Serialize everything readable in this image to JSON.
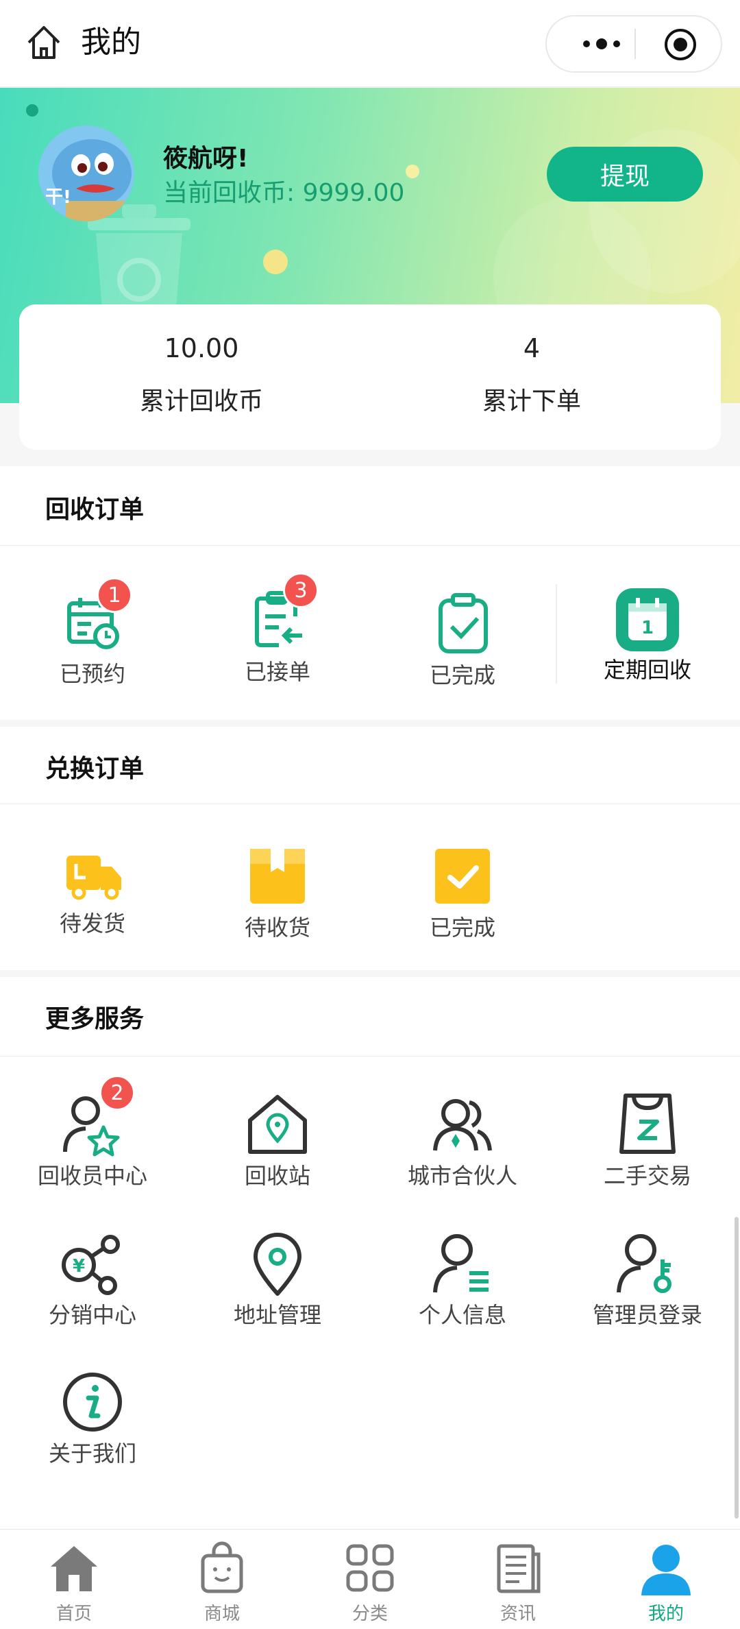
{
  "header": {
    "title": "我的",
    "icons": [
      "home-icon",
      "more-dots-icon",
      "record-target-icon"
    ]
  },
  "user": {
    "name": "筱航呀!",
    "coins_text": "当前回收币: 9999.00",
    "avatar_caption": "干!",
    "withdraw_label": "提现"
  },
  "stats": [
    {
      "value": "10.00",
      "label": "累计回收币"
    },
    {
      "value": "4",
      "label": "累计下单"
    }
  ],
  "recycle_orders": {
    "title": "回收订单",
    "items": [
      {
        "label": "已预约",
        "badge": "1",
        "icon": "calendar-clock-icon"
      },
      {
        "label": "已接单",
        "badge": "3",
        "icon": "clipboard-return-icon"
      },
      {
        "label": "已完成",
        "icon": "clipboard-check-icon"
      },
      {
        "label": "定期回收",
        "icon": "calendar-day-icon"
      }
    ]
  },
  "exchange_orders": {
    "title": "兑换订单",
    "items": [
      {
        "label": "待发货",
        "icon": "truck-icon"
      },
      {
        "label": "待收货",
        "icon": "package-icon"
      },
      {
        "label": "已完成",
        "icon": "check-square-icon"
      }
    ]
  },
  "services": {
    "title": "更多服务",
    "items": [
      {
        "label": "回收员中心",
        "badge": "2",
        "icon": "user-star-icon"
      },
      {
        "label": "回收站",
        "icon": "house-location-icon"
      },
      {
        "label": "城市合伙人",
        "icon": "users-icon"
      },
      {
        "label": "二手交易",
        "icon": "shopping-bag-icon"
      },
      {
        "label": "分销中心",
        "icon": "yen-share-icon"
      },
      {
        "label": "地址管理",
        "icon": "location-pin-icon"
      },
      {
        "label": "个人信息",
        "icon": "user-list-icon"
      },
      {
        "label": "管理员登录",
        "icon": "user-key-icon"
      },
      {
        "label": "关于我们",
        "icon": "info-icon"
      }
    ]
  },
  "tabbar": {
    "items": [
      {
        "label": "首页",
        "icon": "home-tab-icon"
      },
      {
        "label": "商城",
        "icon": "shop-bag-icon"
      },
      {
        "label": "分类",
        "icon": "grid-icon"
      },
      {
        "label": "资讯",
        "icon": "news-icon"
      },
      {
        "label": "我的",
        "icon": "person-icon",
        "active": true
      }
    ]
  },
  "colors": {
    "brand_green": "#12b58a",
    "badge_red": "#f2534f",
    "exchange_yellow": "#fcc21b"
  }
}
